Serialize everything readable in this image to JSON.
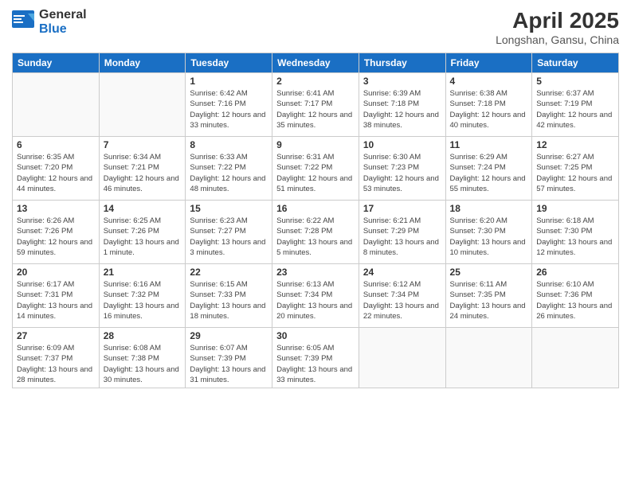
{
  "logo": {
    "general": "General",
    "blue": "Blue"
  },
  "title": {
    "month_year": "April 2025",
    "location": "Longshan, Gansu, China"
  },
  "weekdays": [
    "Sunday",
    "Monday",
    "Tuesday",
    "Wednesday",
    "Thursday",
    "Friday",
    "Saturday"
  ],
  "weeks": [
    [
      {
        "day": "",
        "sunrise": "",
        "sunset": "",
        "daylight": ""
      },
      {
        "day": "",
        "sunrise": "",
        "sunset": "",
        "daylight": ""
      },
      {
        "day": "1",
        "sunrise": "Sunrise: 6:42 AM",
        "sunset": "Sunset: 7:16 PM",
        "daylight": "Daylight: 12 hours and 33 minutes."
      },
      {
        "day": "2",
        "sunrise": "Sunrise: 6:41 AM",
        "sunset": "Sunset: 7:17 PM",
        "daylight": "Daylight: 12 hours and 35 minutes."
      },
      {
        "day": "3",
        "sunrise": "Sunrise: 6:39 AM",
        "sunset": "Sunset: 7:18 PM",
        "daylight": "Daylight: 12 hours and 38 minutes."
      },
      {
        "day": "4",
        "sunrise": "Sunrise: 6:38 AM",
        "sunset": "Sunset: 7:18 PM",
        "daylight": "Daylight: 12 hours and 40 minutes."
      },
      {
        "day": "5",
        "sunrise": "Sunrise: 6:37 AM",
        "sunset": "Sunset: 7:19 PM",
        "daylight": "Daylight: 12 hours and 42 minutes."
      }
    ],
    [
      {
        "day": "6",
        "sunrise": "Sunrise: 6:35 AM",
        "sunset": "Sunset: 7:20 PM",
        "daylight": "Daylight: 12 hours and 44 minutes."
      },
      {
        "day": "7",
        "sunrise": "Sunrise: 6:34 AM",
        "sunset": "Sunset: 7:21 PM",
        "daylight": "Daylight: 12 hours and 46 minutes."
      },
      {
        "day": "8",
        "sunrise": "Sunrise: 6:33 AM",
        "sunset": "Sunset: 7:22 PM",
        "daylight": "Daylight: 12 hours and 48 minutes."
      },
      {
        "day": "9",
        "sunrise": "Sunrise: 6:31 AM",
        "sunset": "Sunset: 7:22 PM",
        "daylight": "Daylight: 12 hours and 51 minutes."
      },
      {
        "day": "10",
        "sunrise": "Sunrise: 6:30 AM",
        "sunset": "Sunset: 7:23 PM",
        "daylight": "Daylight: 12 hours and 53 minutes."
      },
      {
        "day": "11",
        "sunrise": "Sunrise: 6:29 AM",
        "sunset": "Sunset: 7:24 PM",
        "daylight": "Daylight: 12 hours and 55 minutes."
      },
      {
        "day": "12",
        "sunrise": "Sunrise: 6:27 AM",
        "sunset": "Sunset: 7:25 PM",
        "daylight": "Daylight: 12 hours and 57 minutes."
      }
    ],
    [
      {
        "day": "13",
        "sunrise": "Sunrise: 6:26 AM",
        "sunset": "Sunset: 7:26 PM",
        "daylight": "Daylight: 12 hours and 59 minutes."
      },
      {
        "day": "14",
        "sunrise": "Sunrise: 6:25 AM",
        "sunset": "Sunset: 7:26 PM",
        "daylight": "Daylight: 13 hours and 1 minute."
      },
      {
        "day": "15",
        "sunrise": "Sunrise: 6:23 AM",
        "sunset": "Sunset: 7:27 PM",
        "daylight": "Daylight: 13 hours and 3 minutes."
      },
      {
        "day": "16",
        "sunrise": "Sunrise: 6:22 AM",
        "sunset": "Sunset: 7:28 PM",
        "daylight": "Daylight: 13 hours and 5 minutes."
      },
      {
        "day": "17",
        "sunrise": "Sunrise: 6:21 AM",
        "sunset": "Sunset: 7:29 PM",
        "daylight": "Daylight: 13 hours and 8 minutes."
      },
      {
        "day": "18",
        "sunrise": "Sunrise: 6:20 AM",
        "sunset": "Sunset: 7:30 PM",
        "daylight": "Daylight: 13 hours and 10 minutes."
      },
      {
        "day": "19",
        "sunrise": "Sunrise: 6:18 AM",
        "sunset": "Sunset: 7:30 PM",
        "daylight": "Daylight: 13 hours and 12 minutes."
      }
    ],
    [
      {
        "day": "20",
        "sunrise": "Sunrise: 6:17 AM",
        "sunset": "Sunset: 7:31 PM",
        "daylight": "Daylight: 13 hours and 14 minutes."
      },
      {
        "day": "21",
        "sunrise": "Sunrise: 6:16 AM",
        "sunset": "Sunset: 7:32 PM",
        "daylight": "Daylight: 13 hours and 16 minutes."
      },
      {
        "day": "22",
        "sunrise": "Sunrise: 6:15 AM",
        "sunset": "Sunset: 7:33 PM",
        "daylight": "Daylight: 13 hours and 18 minutes."
      },
      {
        "day": "23",
        "sunrise": "Sunrise: 6:13 AM",
        "sunset": "Sunset: 7:34 PM",
        "daylight": "Daylight: 13 hours and 20 minutes."
      },
      {
        "day": "24",
        "sunrise": "Sunrise: 6:12 AM",
        "sunset": "Sunset: 7:34 PM",
        "daylight": "Daylight: 13 hours and 22 minutes."
      },
      {
        "day": "25",
        "sunrise": "Sunrise: 6:11 AM",
        "sunset": "Sunset: 7:35 PM",
        "daylight": "Daylight: 13 hours and 24 minutes."
      },
      {
        "day": "26",
        "sunrise": "Sunrise: 6:10 AM",
        "sunset": "Sunset: 7:36 PM",
        "daylight": "Daylight: 13 hours and 26 minutes."
      }
    ],
    [
      {
        "day": "27",
        "sunrise": "Sunrise: 6:09 AM",
        "sunset": "Sunset: 7:37 PM",
        "daylight": "Daylight: 13 hours and 28 minutes."
      },
      {
        "day": "28",
        "sunrise": "Sunrise: 6:08 AM",
        "sunset": "Sunset: 7:38 PM",
        "daylight": "Daylight: 13 hours and 30 minutes."
      },
      {
        "day": "29",
        "sunrise": "Sunrise: 6:07 AM",
        "sunset": "Sunset: 7:39 PM",
        "daylight": "Daylight: 13 hours and 31 minutes."
      },
      {
        "day": "30",
        "sunrise": "Sunrise: 6:05 AM",
        "sunset": "Sunset: 7:39 PM",
        "daylight": "Daylight: 13 hours and 33 minutes."
      },
      {
        "day": "",
        "sunrise": "",
        "sunset": "",
        "daylight": ""
      },
      {
        "day": "",
        "sunrise": "",
        "sunset": "",
        "daylight": ""
      },
      {
        "day": "",
        "sunrise": "",
        "sunset": "",
        "daylight": ""
      }
    ]
  ]
}
